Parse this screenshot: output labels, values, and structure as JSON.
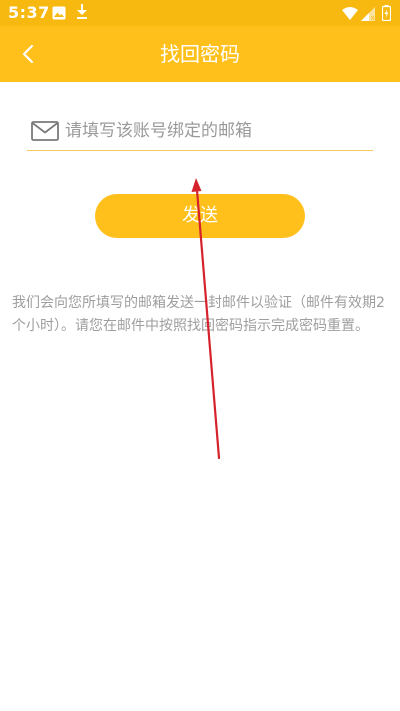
{
  "status_bar": {
    "time": "5:37",
    "icons": [
      "image-icon",
      "download-icon",
      "wifi-icon",
      "signal-icon",
      "battery-icon"
    ]
  },
  "header": {
    "title": "找回密码",
    "back_icon": "chevron-left-icon"
  },
  "form": {
    "email": {
      "icon": "mail-icon",
      "placeholder": "请填写该账号绑定的邮箱",
      "value": ""
    },
    "send_label": "发送"
  },
  "description": "我们会向您所填写的邮箱发送一封邮件以验证（邮件有效期2个小时）。请您在邮件中按照找回密码指示完成密码重置。",
  "colors": {
    "primary": "#FFC01C",
    "status_bar": "#F7B90F",
    "annotation_arrow": "#D6222B"
  }
}
